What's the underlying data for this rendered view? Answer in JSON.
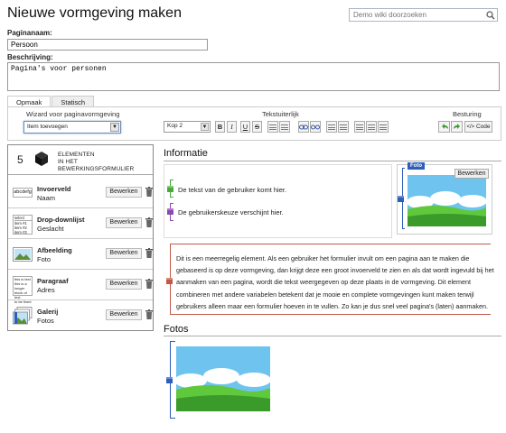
{
  "page": {
    "title": "Nieuwe vormgeving maken",
    "search_placeholder": "Demo wiki doorzoeken"
  },
  "form": {
    "name_label": "Paginanaam:",
    "name_value": "Persoon",
    "desc_label": "Beschrijving:",
    "desc_value": "Pagina's voor personen"
  },
  "tabs": [
    {
      "label": "Opmaak",
      "active": true
    },
    {
      "label": "Statisch",
      "active": false
    }
  ],
  "toolbar": {
    "wizard_label": "Wizard voor paginavormgeving",
    "wizard_value": "Item toevoegen",
    "text_label": "Tekstuiterlijk",
    "format_value": "Kop 2",
    "bold": "B",
    "italic": "I",
    "underline": "U",
    "strike": "S",
    "control_label": "Besturing",
    "code_label": "Code"
  },
  "elements_panel": {
    "count": "5",
    "heading_line1": "ELEMENTEN",
    "heading_line2": "IN HET BEWERKINGSFORMULIER",
    "edit_label": "Bewerken",
    "items": [
      {
        "name": "Invoerveld",
        "sub": "Naam",
        "icon": "text-field-icon",
        "thumb": "abcdefg"
      },
      {
        "name": "Drop-downlijst",
        "sub": "Geslacht",
        "icon": "dropdown-list-icon",
        "thumb_lines": [
          "select",
          "item #1",
          "item #2",
          "item #3"
        ]
      },
      {
        "name": "Afbeelding",
        "sub": "Foto",
        "icon": "image-icon"
      },
      {
        "name": "Paragraaf",
        "sub": "Adres",
        "icon": "paragraph-icon",
        "thumb_lines": [
          "this is text",
          "this is a longer",
          "block of text",
          "to be fixed"
        ]
      },
      {
        "name": "Galerij",
        "sub": "Fotos",
        "icon": "gallery-icon"
      }
    ]
  },
  "preview": {
    "section1_title": "Informatie",
    "field1_text": "De tekst van de gebruiker komt hier.",
    "field2_text": "De gebruikerskeuze verschijnt hier.",
    "image_badge": "Foto",
    "image_edit": "Bewerken",
    "paragraph_text": "Dit is een meerregelig element. Als een gebruiker het formulier invult om een pagina aan te maken die gebaseerd is op deze vormgeving, dan krijgt deze een groot invoerveld te zien en als dat wordt ingevuld bij het aanmaken van een pagina, wordt die tekst weergegeven op deze plaats in de vormgeving. Dit element combineren met andere variabelen betekent dat je mooie en complete vormgevingen kunt maken terwijl gebruikers alleen maar een formulier hoeven in te vullen. Zo kan je dus snel veel pagina's (laten) aanmaken.",
    "section2_title": "Fotos"
  },
  "colors": {
    "green": "#4aa83c",
    "purple": "#8a4ab0",
    "blue": "#2d5fb8",
    "red": "#c0584a",
    "link": "#3a5aa8"
  }
}
